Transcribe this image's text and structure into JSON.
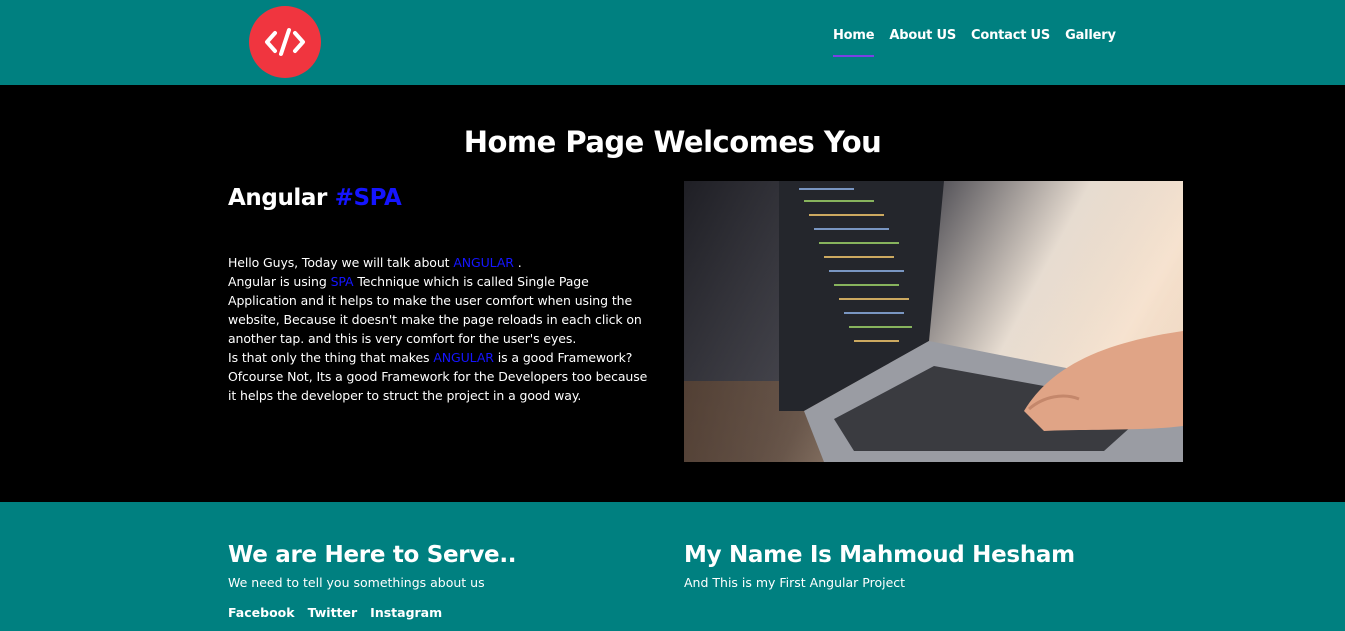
{
  "nav": {
    "logo_icon": "code-icon",
    "items": [
      {
        "label": "Home",
        "active": true
      },
      {
        "label": "About US"
      },
      {
        "label": "Contact US"
      },
      {
        "label": "Gallery"
      }
    ]
  },
  "hero": {
    "title": "Home Page Welcomes You",
    "topic": "Angular",
    "topic_tag": "#SPA",
    "para": {
      "l1a": "Hello Guys, Today we will talk about ",
      "l1b": "ANGULAR",
      "l1c": " .",
      "l2a": "Angular is using ",
      "l2b": "SPA",
      "l2c": " Technique which is called Single Page Application and it helps to make the user comfort when using the website, Because it doesn't make the page reloads in each click on another tap. and this is very comfort for the user's eyes.",
      "l3a": "Is that only the thing that makes ",
      "l3b": "ANGULAR",
      "l3c": " is a good Framework? Ofcourse Not, Its a good Framework for the Developers too because it helps the developer to struct the project in a good way."
    }
  },
  "footer": {
    "left": {
      "title": "We are Here to Serve..",
      "sub": "We need to tell you somethings about us",
      "links": [
        "Facebook",
        "Twitter",
        "Instagram"
      ]
    },
    "right": {
      "title": "My Name Is Mahmoud Hesham",
      "sub": "And This is my First Angular Project"
    }
  },
  "colors": {
    "teal": "#008080",
    "logo_red": "#f0353f",
    "highlight_blue": "#1515ff",
    "active_underline": "#7b3fe4"
  }
}
